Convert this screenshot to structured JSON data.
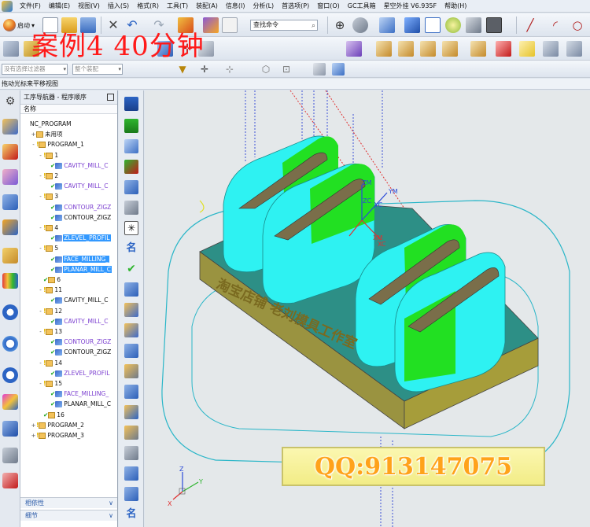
{
  "menu": {
    "items": [
      "文件(F)",
      "编辑(E)",
      "视图(V)",
      "插入(S)",
      "格式(R)",
      "工具(T)",
      "装配(A)",
      "信息(I)",
      "分析(L)",
      "首选项(P)",
      "窗口(O)",
      "GC工具箱",
      "星空外挂 V6.935F",
      "帮助(H)"
    ]
  },
  "toolbar": {
    "start_label": "启动",
    "find_command_placeholder": "查找命令"
  },
  "filter": {
    "selection_filter": "没有选择过滤器",
    "assembly_scope": "整个装配"
  },
  "overlay_title": "案例4   40分钟",
  "status_text": "拖动光标来平移视图",
  "navigator": {
    "title": "工序导航器 - 程序顺序",
    "column_name": "名称",
    "rows": [
      {
        "label": "NC_PROGRAM",
        "indent": 0,
        "expand": "",
        "icon": "",
        "style": "",
        "selected": false
      },
      {
        "label": "未用项",
        "indent": 1,
        "expand": "+",
        "icon": "prog",
        "style": "",
        "selected": false
      },
      {
        "label": "PROGRAM_1",
        "indent": 1,
        "expand": "-",
        "icon": "key-prog",
        "style": "",
        "selected": false
      },
      {
        "label": "1",
        "indent": 2,
        "expand": "-",
        "icon": "key-prog",
        "style": "",
        "selected": false
      },
      {
        "label": "CAVITY_MILL_C",
        "indent": 3,
        "expand": "",
        "icon": "check-op",
        "style": "pink",
        "selected": false
      },
      {
        "label": "2",
        "indent": 2,
        "expand": "-",
        "icon": "key-prog",
        "style": "",
        "selected": false
      },
      {
        "label": "CAVITY_MILL_C",
        "indent": 3,
        "expand": "",
        "icon": "check-op",
        "style": "pink",
        "selected": false
      },
      {
        "label": "3",
        "indent": 2,
        "expand": "-",
        "icon": "key-prog",
        "style": "",
        "selected": false
      },
      {
        "label": "CONTOUR_ZIGZ",
        "indent": 3,
        "expand": "",
        "icon": "check-op",
        "style": "pink",
        "selected": false
      },
      {
        "label": "CONTOUR_ZIGZ",
        "indent": 3,
        "expand": "",
        "icon": "check-op",
        "style": "",
        "selected": false
      },
      {
        "label": "4",
        "indent": 2,
        "expand": "-",
        "icon": "key-prog",
        "style": "",
        "selected": false
      },
      {
        "label": "ZLEVEL_PROFIL",
        "indent": 3,
        "expand": "",
        "icon": "check-op",
        "style": "",
        "selected": true
      },
      {
        "label": "5",
        "indent": 2,
        "expand": "-",
        "icon": "key-prog",
        "style": "",
        "selected": false
      },
      {
        "label": "FACE_MILLING_",
        "indent": 3,
        "expand": "",
        "icon": "check-op",
        "style": "",
        "selected": true
      },
      {
        "label": "PLANAR_MILL_C",
        "indent": 3,
        "expand": "",
        "icon": "check-op",
        "style": "",
        "selected": true
      },
      {
        "label": "6",
        "indent": 2,
        "expand": "",
        "icon": "check-prog",
        "style": "",
        "selected": false
      },
      {
        "label": "11",
        "indent": 2,
        "expand": "-",
        "icon": "key-prog",
        "style": "",
        "selected": false
      },
      {
        "label": "CAVITY_MILL_C",
        "indent": 3,
        "expand": "",
        "icon": "check-op",
        "style": "",
        "selected": false
      },
      {
        "label": "12",
        "indent": 2,
        "expand": "-",
        "icon": "key-prog",
        "style": "",
        "selected": false
      },
      {
        "label": "CAVITY_MILL_C",
        "indent": 3,
        "expand": "",
        "icon": "check-op",
        "style": "pink",
        "selected": false
      },
      {
        "label": "13",
        "indent": 2,
        "expand": "-",
        "icon": "key-prog",
        "style": "",
        "selected": false
      },
      {
        "label": "CONTOUR_ZIGZ",
        "indent": 3,
        "expand": "",
        "icon": "check-op",
        "style": "pink",
        "selected": false
      },
      {
        "label": "CONTOUR_ZIGZ",
        "indent": 3,
        "expand": "",
        "icon": "check-op",
        "style": "",
        "selected": false
      },
      {
        "label": "14",
        "indent": 2,
        "expand": "-",
        "icon": "key-prog",
        "style": "",
        "selected": false
      },
      {
        "label": "ZLEVEL_PROFIL",
        "indent": 3,
        "expand": "",
        "icon": "check-op",
        "style": "pink",
        "selected": false
      },
      {
        "label": "15",
        "indent": 2,
        "expand": "-",
        "icon": "key-prog",
        "style": "",
        "selected": false
      },
      {
        "label": "FACE_MILLING_",
        "indent": 3,
        "expand": "",
        "icon": "check-op",
        "style": "pink",
        "selected": false
      },
      {
        "label": "PLANAR_MILL_C",
        "indent": 3,
        "expand": "",
        "icon": "check-op",
        "style": "",
        "selected": false
      },
      {
        "label": "16",
        "indent": 2,
        "expand": "",
        "icon": "check-prog",
        "style": "",
        "selected": false
      },
      {
        "label": "PROGRAM_2",
        "indent": 1,
        "expand": "+",
        "icon": "key-prog",
        "style": "",
        "selected": false
      },
      {
        "label": "PROGRAM_3",
        "indent": 1,
        "expand": "+",
        "icon": "key-prog",
        "style": "",
        "selected": false
      }
    ],
    "footer_dependencies": "相依性",
    "footer_details": "细节"
  },
  "viewport": {
    "axis_labels": [
      "ZM",
      "YM",
      "ZC",
      "YC",
      "XM",
      "XC"
    ],
    "triad_labels": [
      "Z",
      "Y",
      "X"
    ],
    "watermark": "淘宝店铺  老刘模具工作室"
  },
  "banner": "QQ:913147075",
  "colors": {
    "part_cyan": "#2ef2f2",
    "part_green": "#22e022",
    "base_plate": "#2d8f86",
    "base_side": "#9a9340",
    "selection": "#3399ff",
    "overlay_red": "#ff1a1a",
    "banner_text": "#ffa21a"
  }
}
